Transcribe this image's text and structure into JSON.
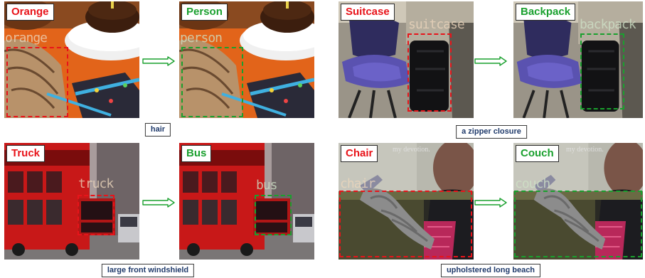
{
  "examples": [
    {
      "original_tag": "Orange",
      "detected_label_orig": "orange",
      "target_tag": "Person",
      "detected_label_target": "person",
      "caption": "hair"
    },
    {
      "original_tag": "Suitcase",
      "detected_label_orig": "suitcase",
      "target_tag": "Backpack",
      "detected_label_target": "backpack",
      "caption": "a zipper closure"
    },
    {
      "original_tag": "Truck",
      "detected_label_orig": "truck",
      "target_tag": "Bus",
      "detected_label_target": "bus",
      "caption": "large front windshield"
    },
    {
      "original_tag": "Chair",
      "detected_label_orig": "chair",
      "target_tag": "Couch",
      "detected_label_target": "couch",
      "caption": "upholstered long beach",
      "watermark": "my devotion."
    }
  ],
  "colors": {
    "original_label": "#e8141a",
    "target_label": "#1aa02e",
    "caption_text": "#1f3a6b"
  },
  "icons": [
    "right-arrow-icon"
  ]
}
